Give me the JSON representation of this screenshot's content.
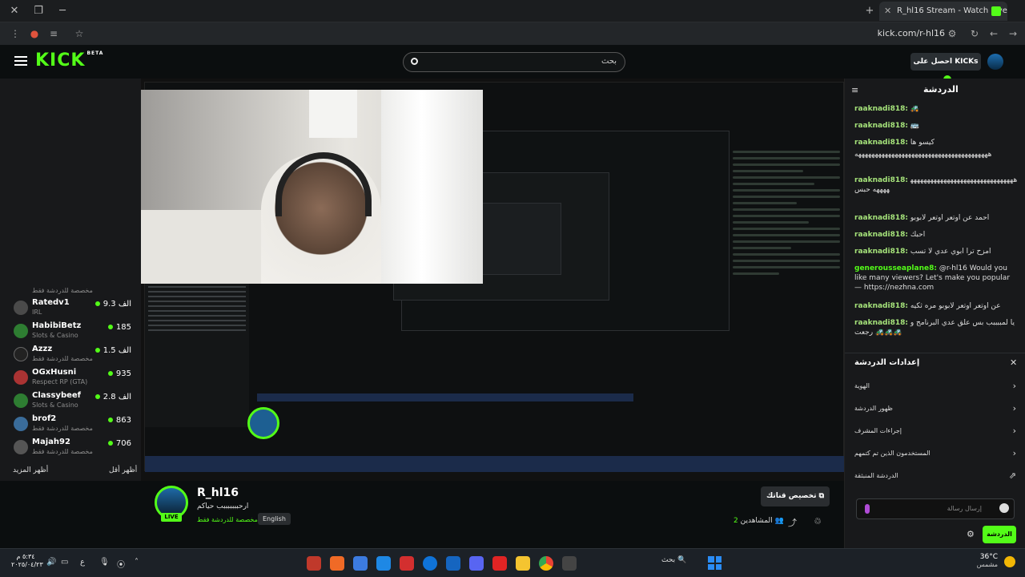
{
  "browser": {
    "tab_title": "R_hl16 Stream - Watch Live on",
    "url": "kick.com/r-hl16"
  },
  "header": {
    "logo": "KICK",
    "logo_badge": "BETA",
    "search_placeholder": "بحث",
    "kicks_label": "احصل على KICKs"
  },
  "sidebar": {
    "top_category": "مخصصة للدردشة فقط",
    "channels": [
      {
        "name": "Ratedv1",
        "category": "IRL",
        "viewers": "9.3 الف"
      },
      {
        "name": "HabibiBetz",
        "category": "Slots & Casino",
        "viewers": "185"
      },
      {
        "name": "Azzz",
        "category": "مخصصة للدردشة فقط",
        "viewers": "1.5 الف"
      },
      {
        "name": "OGxHusni",
        "category": "Respect RP (GTA)",
        "viewers": "935"
      },
      {
        "name": "Classybeef",
        "category": "Slots & Casino",
        "viewers": "2.8 الف"
      },
      {
        "name": "brof2",
        "category": "مخصصة للدردشة فقط",
        "viewers": "863"
      },
      {
        "name": "Majah92",
        "category": "مخصصة للدردشة فقط",
        "viewers": "706"
      }
    ],
    "show_more": "أظهر المزيد",
    "show_less": "أظهر أقل"
  },
  "stream_info": {
    "streamer": "R_hl16",
    "title": "ارحبببببببب حياكم",
    "category": "مخصصة للدردشة فقط",
    "language": "English",
    "live_label": "LIVE",
    "customize_label": "تخصيص قناتك",
    "viewers_label": "المشاهدين",
    "viewers_count": "2"
  },
  "chat": {
    "title": "الدردشة",
    "messages": [
      {
        "user": "raaknadi818:",
        "text": "🚜"
      },
      {
        "user": "raaknadi818:",
        "text": "🚌"
      },
      {
        "user": "raaknadi818:",
        "text": "كيسو ها"
      },
      {
        "user": "raaknadi818:",
        "text": "ههههههههههههههههههههههههههههههههههههههههه"
      },
      {
        "user": "raaknadi818:",
        "text": "ههههههههههههههههههههههههههههههههههههه حبس"
      },
      {
        "user": "raaknadi818:",
        "text": "احمد عن اوتعر اوتعر لابوبو"
      },
      {
        "user": "raaknadi818:",
        "text": "احبك"
      },
      {
        "user": "raaknadi818:",
        "text": "امزح ترا ابوي عدي لا تسب"
      },
      {
        "user": "generousseaplane8:",
        "text": "@r-hl16 Would you like many viewers? Let's make you popular — https://nezhna.com"
      },
      {
        "user": "raaknadi818:",
        "text": "عن اوتعر اوتعر لابوبو مره ثكيه"
      },
      {
        "user": "raaknadi818:",
        "text": "يا لمببببب بس علق عدي البرنامج و رجعت 🚜🚜🚜"
      }
    ],
    "settings_title": "إعدادات الدردشة",
    "settings_items": [
      "الهوية",
      "ظهور الدردشة",
      "إجراءات المشرف",
      "المستخدمون الذين تم كتمهم",
      "الدردشة المنبثقة"
    ],
    "message_placeholder": "إرسال رسالة",
    "chat_button": "الدردشة"
  },
  "taskbar": {
    "search_label": "بحث",
    "weather_temp": "36°C",
    "weather_desc": "مشمس",
    "time": "٥:٣٤ م",
    "date": "٢٠٢٥/٠٤/٢٣",
    "lang": "ع"
  },
  "colors": {
    "accent": "#53fc18",
    "bg": "#0b0e0f",
    "panel": "#18191b"
  }
}
